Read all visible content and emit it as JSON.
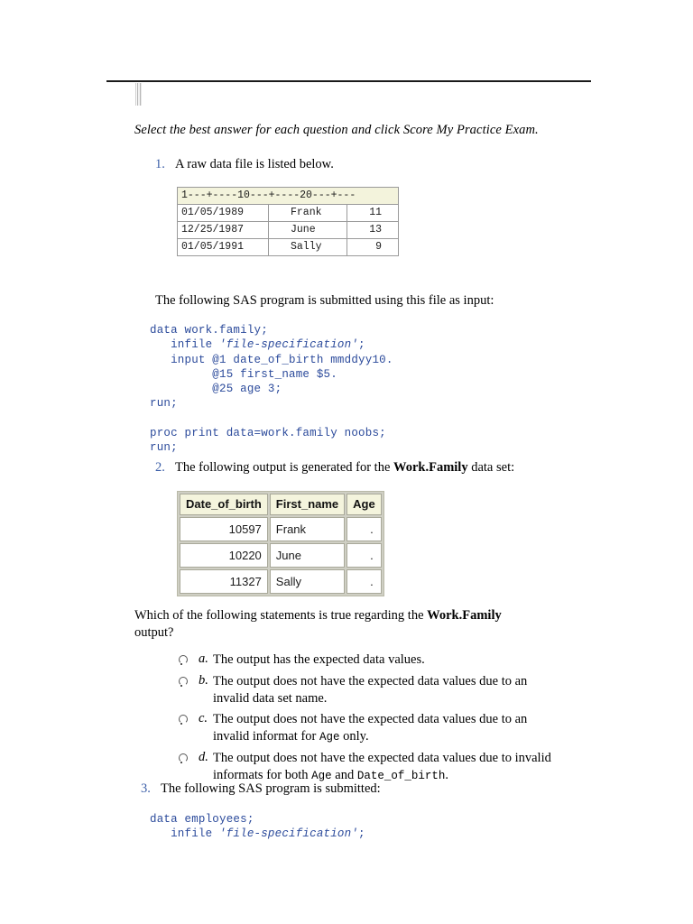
{
  "document": {
    "intro_instruction": "Select the best answer for each question and click Score My Practice Exam.",
    "questions": {
      "q1": {
        "number": "1.",
        "text": "A raw data file is listed below."
      },
      "q2": {
        "number": "2.",
        "text_before": "The following output is generated for the ",
        "bold": "Work.Family",
        "text_after": " data set:"
      },
      "q3": {
        "number": "3.",
        "text": "The following SAS program is submitted:"
      }
    },
    "program_intro": "The following SAS program is submitted using this file as input:",
    "question_prompt": {
      "line1_before": "Which of the following statements is true regarding the ",
      "line1_bold": "Work.Family",
      "line2": "output?"
    }
  },
  "raw_data_table": {
    "ruler": "1---+----10---+----20---+---",
    "rows": [
      {
        "date": "01/05/1989",
        "name": "Frank",
        "age": "11"
      },
      {
        "date": "12/25/1987",
        "name": "June",
        "age": "13"
      },
      {
        "date": "01/05/1991",
        "name": "Sally",
        "age": "9"
      }
    ]
  },
  "sas_program_1": {
    "line1": "data work.family;",
    "line2_pre": "   infile ",
    "line2_italic": "'file-specification'",
    "line2_post": ";",
    "line3": "   input @1 date_of_birth mmddyy10.",
    "line4": "         @15 first_name $5.",
    "line5": "         @25 age 3;",
    "line6": "run;",
    "line7": "",
    "line8": "proc print data=work.family noobs;",
    "line9": "run;"
  },
  "sas_program_2": {
    "line1": "data employees;",
    "line2_pre": "   infile ",
    "line2_italic": "'file-specification'",
    "line2_post": ";"
  },
  "output_table": {
    "headers": [
      "Date_of_birth",
      "First_name",
      "Age"
    ],
    "rows": [
      {
        "date_of_birth": "10597",
        "first_name": "Frank",
        "age": "."
      },
      {
        "date_of_birth": "10220",
        "first_name": "June",
        "age": "."
      },
      {
        "date_of_birth": "11327",
        "first_name": "Sally",
        "age": "."
      }
    ]
  },
  "answer_options": [
    {
      "letter": "a.",
      "text_1": "The output has the expected data values.",
      "mono_1": "",
      "text_2": "",
      "mono_2": "",
      "text_3": ""
    },
    {
      "letter": "b.",
      "text_1": "The output does not have the expected data values due to an invalid data set name.",
      "mono_1": "",
      "text_2": "",
      "mono_2": "",
      "text_3": ""
    },
    {
      "letter": "c.",
      "text_1": "The output does not have the expected data values due to an invalid informat for ",
      "mono_1": "Age",
      "text_2": " only.",
      "mono_2": "",
      "text_3": ""
    },
    {
      "letter": "d.",
      "text_1": "The output does not have the expected data values due to invalid informats for both ",
      "mono_1": "Age",
      "text_2": " and ",
      "mono_2": "Date_of_birth",
      "text_3": "."
    }
  ],
  "colors": {
    "code_blue": "#2b4a9b",
    "list_number_blue": "#3b5ea8",
    "table_header_cream": "#f4f4dd",
    "table_border": "#a9a99a",
    "rule_black": "#1a1a1a"
  }
}
